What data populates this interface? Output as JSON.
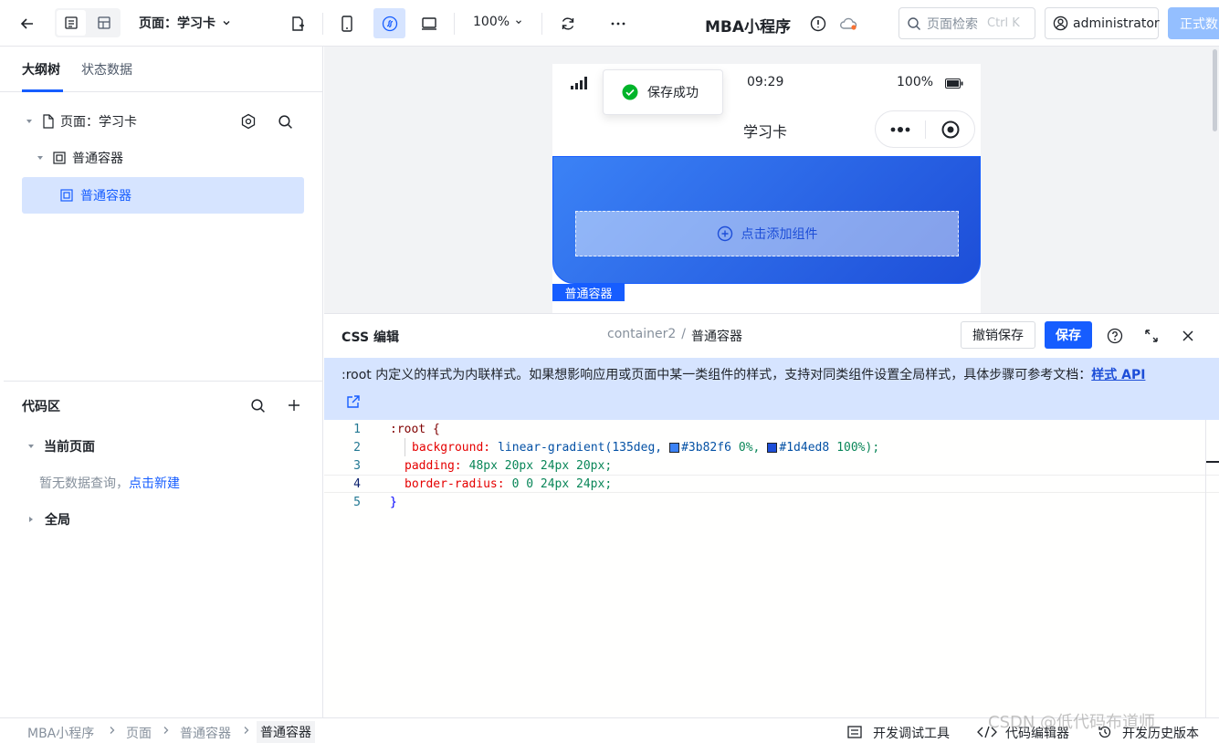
{
  "topbar": {
    "page_selector": "页面：学习卡",
    "zoom": "100%",
    "app_title": "MBA小程序",
    "search_placeholder": "页面检索",
    "search_shortcut": "Ctrl K",
    "user": "administrator",
    "publish_label": "正式数"
  },
  "left_panel": {
    "tabs": [
      "大纲树",
      "状态数据"
    ],
    "tree": [
      "页面：学习卡",
      "普通容器",
      "普通容器"
    ],
    "code_area_title": "代码区",
    "current_page": "当前页面",
    "empty_text": "暂无数据查询，",
    "create_link": "点击新建",
    "global": "全局"
  },
  "phone": {
    "time": "09:29",
    "battery": "100%",
    "nav_title": "学习卡",
    "add_component": "点击添加组件",
    "selected_label": "普通容器",
    "toast": "保存成功"
  },
  "css_editor": {
    "title": "CSS 编辑",
    "path_root": "container2",
    "path_sep": "/",
    "path_leaf": "普通容器",
    "revert_label": "撤销保存",
    "save_label": "保存",
    "notice": ":root 内定义的样式为内联样式。如果想影响应用或页面中某一类组件的样式，支持对同类组件设置全局样式，具体步骤可参考文档：",
    "notice_link": "样式 API",
    "code": {
      "l1": ":root {",
      "l2_prop": "background:",
      "l2_fn": "linear-gradient(135deg,",
      "l2_c1": "#3b82f6",
      "l2_p1": "0%,",
      "l2_c2": "#1d4ed8",
      "l2_p2": "100%);",
      "l3_prop": "padding:",
      "l3_val": "48px 20px 24px 20px;",
      "l4_prop": "border-radius:",
      "l4_val": "0 0 24px 24px;",
      "l5": "}"
    },
    "line_numbers": [
      "1",
      "2",
      "3",
      "4",
      "5"
    ]
  },
  "footer": {
    "breadcrumb": [
      "MBA小程序",
      "页面",
      "普通容器",
      "普通容器"
    ],
    "debug_tool": "开发调试工具",
    "code_editor": "代码编辑器",
    "history": "开发历史版本"
  },
  "watermark": "CSDN @低代码布道师",
  "colors": {
    "accent": "#165dff",
    "gradient_start": "#3b82f6",
    "gradient_end": "#1d4ed8",
    "success": "#00b42a"
  }
}
